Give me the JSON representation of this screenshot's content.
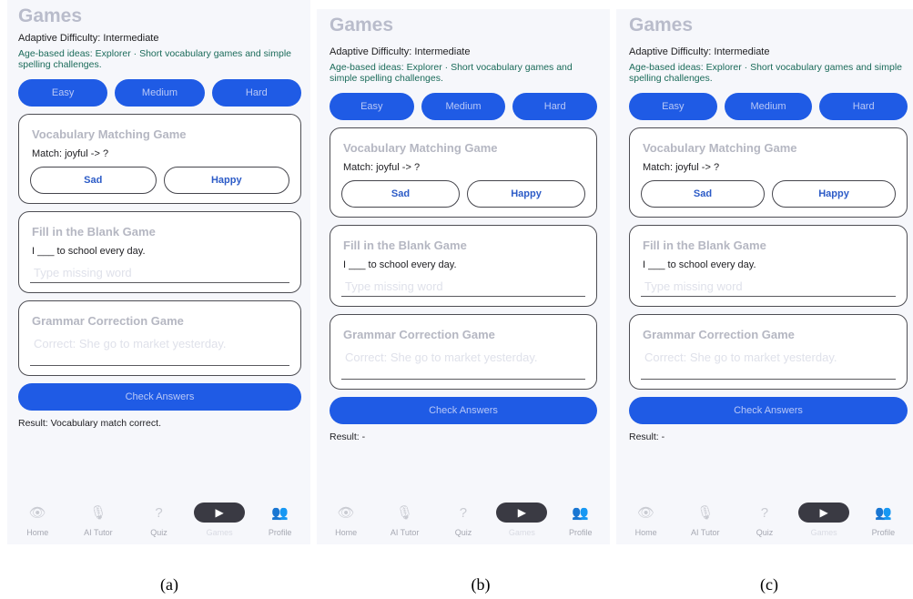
{
  "panels": [
    {
      "caption": "(a)",
      "title": "Games",
      "difficulty": "Adaptive Difficulty: Intermediate",
      "age_ideas": "Age-based ideas: Explorer · Short vocabulary games and simple spelling challenges.",
      "levels": [
        "Easy",
        "Medium",
        "Hard"
      ],
      "vocab": {
        "title": "Vocabulary Matching Game",
        "prompt": "Match: joyful -> ?",
        "options": [
          "Sad",
          "Happy"
        ]
      },
      "fill": {
        "title": "Fill in the Blank Game",
        "prompt": "I ___ to school every day.",
        "placeholder": "Type missing word"
      },
      "grammar": {
        "title": "Grammar Correction Game",
        "placeholder": "Correct: She go to market yesterday."
      },
      "check_label": "Check Answers",
      "result": "Result: Vocabulary match correct."
    },
    {
      "caption": "(b)",
      "title": "Games",
      "difficulty": "Adaptive Difficulty: Intermediate",
      "age_ideas": "Age-based ideas: Explorer · Short vocabulary games and simple spelling challenges.",
      "levels": [
        "Easy",
        "Medium",
        "Hard"
      ],
      "vocab": {
        "title": "Vocabulary Matching Game",
        "prompt": "Match: joyful -> ?",
        "options": [
          "Sad",
          "Happy"
        ]
      },
      "fill": {
        "title": "Fill in the Blank Game",
        "prompt": "I ___ to school every day.",
        "placeholder": "Type missing word"
      },
      "grammar": {
        "title": "Grammar Correction Game",
        "placeholder": "Correct: She go to market yesterday."
      },
      "check_label": "Check Answers",
      "result": "Result: -"
    },
    {
      "caption": "(c)",
      "title": "Games",
      "difficulty": "Adaptive Difficulty: Intermediate",
      "age_ideas": "Age-based ideas: Explorer · Short vocabulary games and simple spelling challenges.",
      "levels": [
        "Easy",
        "Medium",
        "Hard"
      ],
      "vocab": {
        "title": "Vocabulary Matching Game",
        "prompt": "Match: joyful -> ?",
        "options": [
          "Sad",
          "Happy"
        ]
      },
      "fill": {
        "title": "Fill in the Blank Game",
        "prompt": "I ___ to school every day.",
        "placeholder": "Type missing word"
      },
      "grammar": {
        "title": "Grammar Correction Game",
        "placeholder": "Correct: She go to market yesterday."
      },
      "check_label": "Check Answers",
      "result": "Result: -"
    }
  ],
  "nav": {
    "items": [
      {
        "label": "Home",
        "icon": "eye-icon"
      },
      {
        "label": "AI Tutor",
        "icon": "microphone-icon"
      },
      {
        "label": "Quiz",
        "icon": "question-icon"
      },
      {
        "label": "Games",
        "icon": "play-icon",
        "active": true
      },
      {
        "label": "Profile",
        "icon": "profile-icon"
      }
    ]
  },
  "colors": {
    "primary": "#1f5be5",
    "primary_text": "#b9c8f7",
    "title_muted": "#b9bccb",
    "age_text": "#1b6b5a",
    "active_nav": "#3a3a43"
  }
}
